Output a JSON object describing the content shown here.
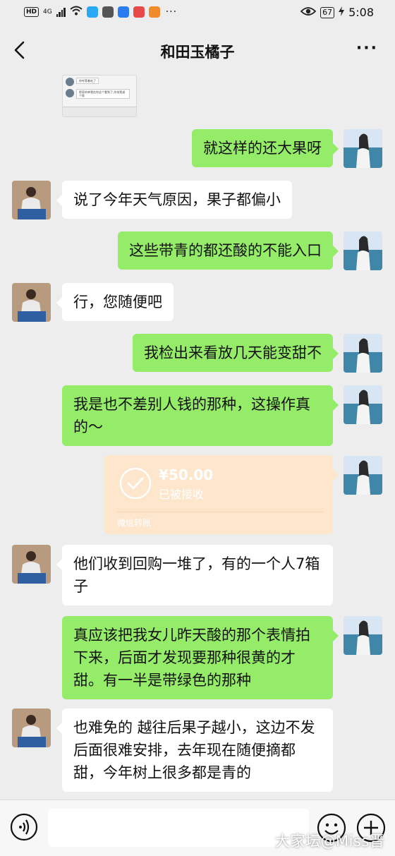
{
  "status_bar": {
    "left_badge": "HD",
    "network": "4G",
    "battery": "67",
    "time": "5:08",
    "app_icon_colors": [
      "#29a9f5",
      "#555555",
      "#2a7df1",
      "#e84a4a",
      "#f08a2a"
    ]
  },
  "header": {
    "title": "和田玉橘子",
    "back_icon": "chevron-left-icon",
    "more_icon": "more-dots-icon"
  },
  "quoted_image": {
    "line1": "你咋等着吃了",
    "line2": "那家的单我在你这个看到了,先给我退个款"
  },
  "messages": [
    {
      "side": "right",
      "type": "text",
      "text": "就这样的还大果呀"
    },
    {
      "side": "left",
      "type": "text",
      "text": "说了今年天气原因，果子都偏小"
    },
    {
      "side": "right",
      "type": "text",
      "text": "这些带青的都还酸的不能入口"
    },
    {
      "side": "left",
      "type": "text",
      "text": "行，您随便吧"
    },
    {
      "side": "right",
      "type": "text",
      "text": "我检出来看放几天能变甜不"
    },
    {
      "side": "right",
      "type": "text",
      "text": "我是也不差别人钱的那种，这操作真的～"
    },
    {
      "side": "right",
      "type": "transfer",
      "amount": "¥50.00",
      "status": "已被接收",
      "label": "微信转账"
    },
    {
      "side": "left",
      "type": "text",
      "text": "他们收到回购一堆了，有的一个人7箱子"
    },
    {
      "side": "right",
      "type": "text",
      "text": "真应该把我女儿昨天酸的那个表情拍下来，后面才发现要那种很黄的才甜。有一半是带绿色的那种"
    },
    {
      "side": "left",
      "type": "text",
      "text": "也难免的 越往后果子越小，这边不发后面很难安排，去年现在随便摘都甜，今年树上很多都是青的"
    }
  ],
  "input_bar": {
    "voice_icon": "voice-icon",
    "emoji_icon": "emoji-icon",
    "plus_icon": "plus-icon",
    "input_value": ""
  },
  "watermark": "大家坛@Miss晋",
  "colors": {
    "background": "#ededed",
    "sent_bubble": "#95ec69",
    "received_bubble": "#ffffff",
    "transfer_card": "#fde6cc"
  }
}
